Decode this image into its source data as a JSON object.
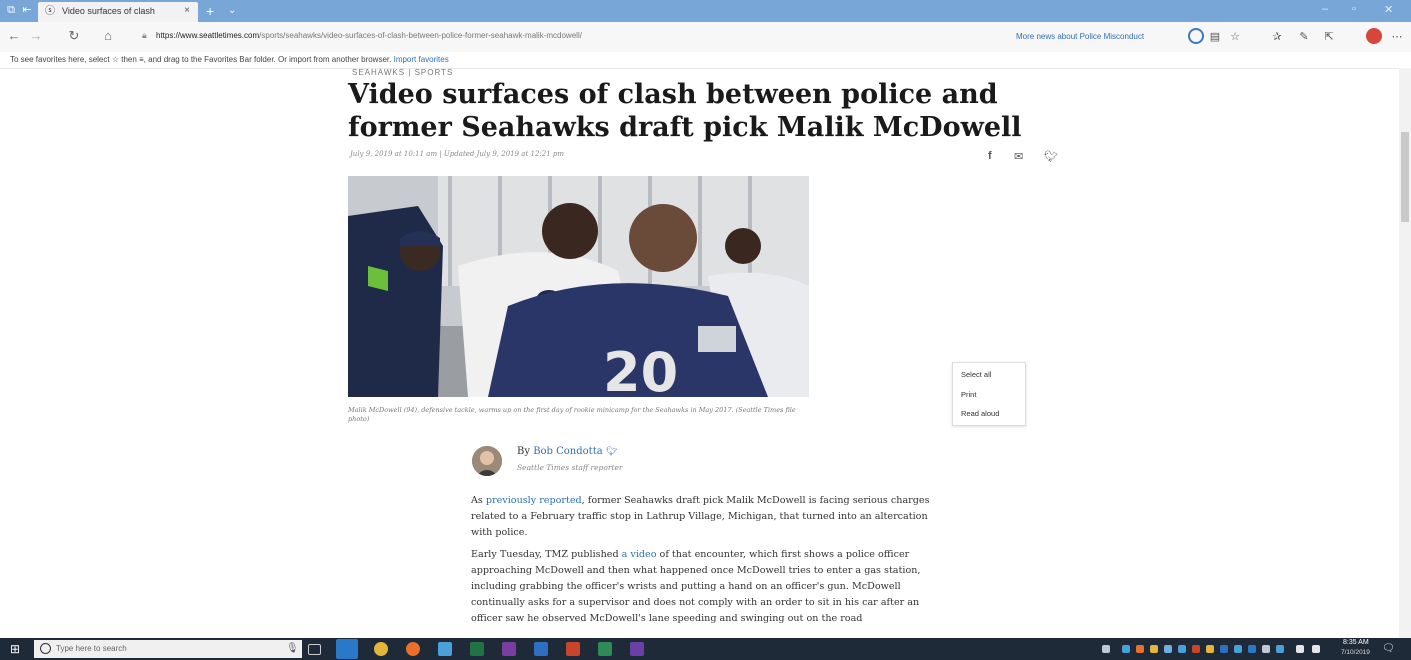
{
  "browser": {
    "tab": {
      "title": "Video surfaces of clash",
      "close": "×",
      "add": "+",
      "menu": "⌄"
    },
    "address": {
      "url_domain": "https://www.seattletimes.com",
      "url_path": "/sports/seahawks/video-surfaces-of-clash-between-police-former-seahawk-malik-mcdowell/",
      "more_news": "More news about Police Misconduct"
    },
    "favorites_bar": {
      "text": "To see favorites here, select ☆ then ≡, and drag to the Favorites Bar folder. Or import from another browser.",
      "link": "Import favorites"
    }
  },
  "article": {
    "section": "SEAHAWKS | SPORTS",
    "headline": "Video surfaces of clash between police and former Seahawks draft pick Malik McDowell",
    "dateline": "July 9, 2019 at 10:11 am | Updated July 9, 2019 at 12:21 pm",
    "caption": "Malik McDowell (94), defensive tackle, warms up on the first day of rookie minicamp for the Seahawks in May 2017. (Seattle Times file photo)",
    "byline_prefix": "By ",
    "author": "Bob Condotta",
    "author_role": "Seattle Times staff reporter",
    "p1_before": "As ",
    "p1_link": "previously reported",
    "p1_after": ", former Seahawks draft pick Malik McDowell is facing serious charges related to a February traffic stop in Lathrup Village, Michigan, that turned into an altercation with police.",
    "p2_before": "Early Tuesday, TMZ published ",
    "p2_link": "a video",
    "p2_after": " of that encounter, which first shows a police officer approaching McDowell and then what happened once McDowell tries to enter a gas station, including grabbing the officer's wrists and putting a hand on an officer's gun. McDowell continually asks for a supervisor and does not comply with an order to sit in his car after an officer saw he observed McDowell's lane speeding and swinging out on the road"
  },
  "context_menu": {
    "items": [
      "Select all",
      "Print",
      "Read aloud"
    ]
  },
  "taskbar": {
    "search_placeholder": "Type here to search",
    "time": "8:35 AM",
    "date": "7/10/2019"
  },
  "colors": {
    "titlebar": "#78a6d6",
    "link": "#2f6fb6",
    "taskbar": "#1f2a38"
  }
}
